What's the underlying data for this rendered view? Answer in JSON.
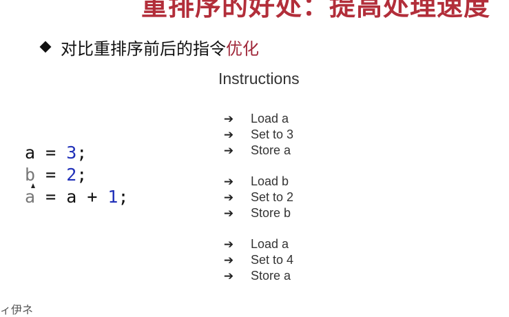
{
  "slide": {
    "title": "重排序的好处：提高处理速度",
    "bullet": {
      "text": "对比重排序前后的指令",
      "highlight": "优化"
    },
    "code": {
      "line1": {
        "var": "a",
        "op": " = ",
        "val": "3",
        "end": ";"
      },
      "line2": {
        "var": "b",
        "op": " = ",
        "val": "2",
        "end": ";"
      },
      "line3": {
        "var": "a",
        "op": " = a + ",
        "val": "1",
        "end": ";"
      }
    },
    "instructions": {
      "title": "Instructions",
      "arrow": "➔",
      "group1": [
        "Load a",
        "Set to 3",
        "Store a"
      ],
      "group2": [
        "Load b",
        "Set to 2",
        "Store b"
      ],
      "group3": [
        "Load a",
        "Set to 4",
        "Store a"
      ]
    },
    "bottom_fragment": "ィ伊ネ"
  },
  "colors": {
    "title": "#b22e3a",
    "highlight": "#a0283a",
    "number": "#1f2fb8"
  }
}
